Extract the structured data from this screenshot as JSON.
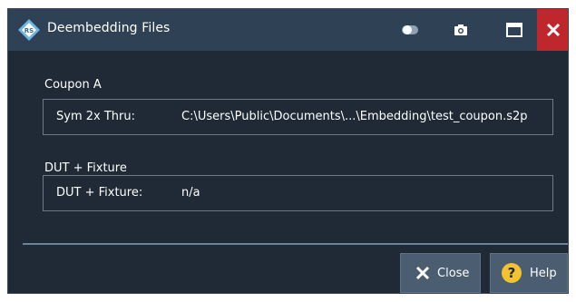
{
  "window": {
    "title": "Deembedding Files",
    "colors": {
      "titlebar": "#2f4154",
      "body": "#1f2a36",
      "close": "#c0272d",
      "button": "#4b5d70"
    }
  },
  "titlebar_buttons": [
    {
      "name": "toggle-icon"
    },
    {
      "name": "camera-icon"
    },
    {
      "name": "maximize-icon"
    },
    {
      "name": "close-icon"
    }
  ],
  "coupon": {
    "group_label": "Coupon A",
    "field_label": "Sym 2x Thru:",
    "field_value": "C:\\Users\\Public\\Documents\\...\\Embedding\\test_coupon.s2p"
  },
  "dut": {
    "group_label": "DUT + Fixture",
    "field_label": "DUT + Fixture:",
    "field_value": "n/a"
  },
  "buttons": {
    "close_label": "Close",
    "help_label": "Help"
  }
}
